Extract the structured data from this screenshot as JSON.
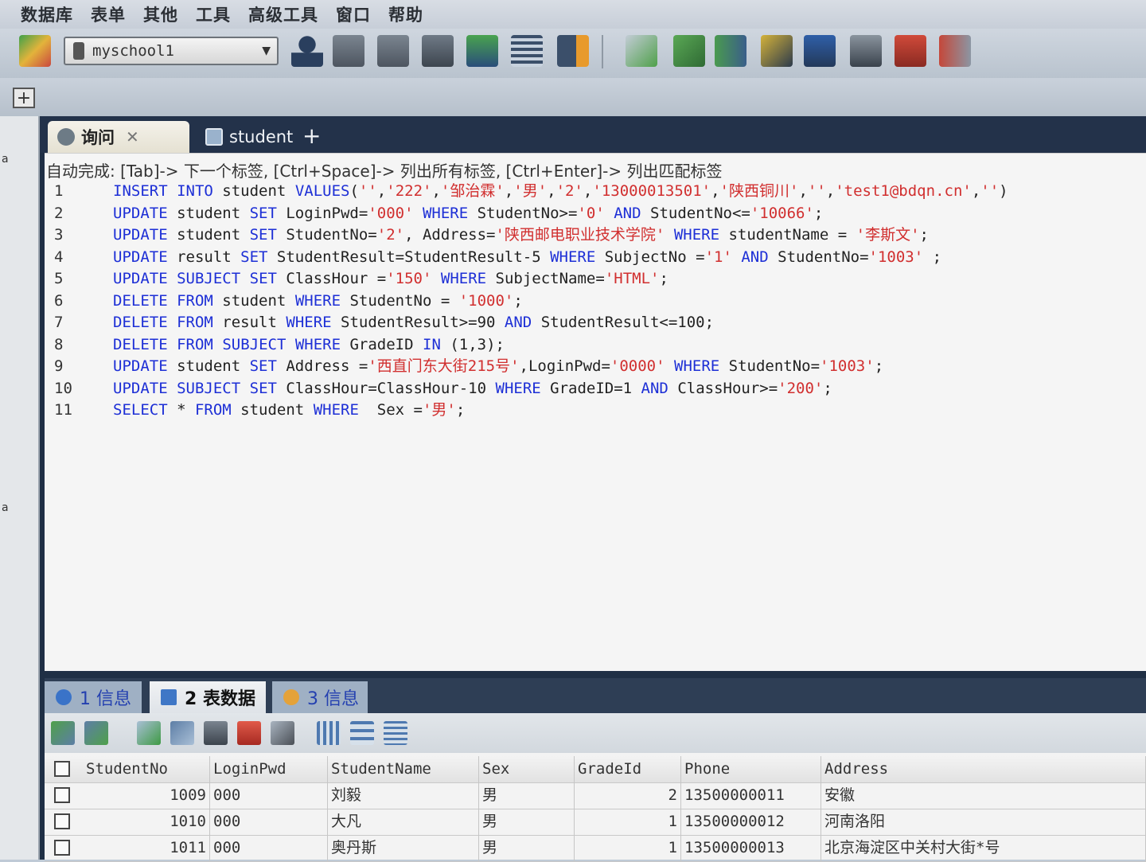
{
  "menu": [
    "数据库",
    "表单",
    "其他",
    "工具",
    "高级工具",
    "窗口",
    "帮助"
  ],
  "toolbar": {
    "database": "myschool1"
  },
  "side_labels": [
    "a",
    "a"
  ],
  "editor_tabs": [
    {
      "label": "询问",
      "active": true
    },
    {
      "label": "student",
      "active": false
    }
  ],
  "editor_hint": "自动完成: [Tab]-> 下一个标签, [Ctrl+Space]-> 列出所有标签, [Ctrl+Enter]-> 列出匹配标签",
  "code_lines": [
    {
      "n": "1",
      "tokens": [
        [
          "k",
          "INSERT"
        ],
        [
          "p",
          " "
        ],
        [
          "k",
          "INTO"
        ],
        [
          "p",
          " student "
        ],
        [
          "k",
          "VALUES"
        ],
        [
          "p",
          "("
        ],
        [
          "s",
          "''"
        ],
        [
          "p",
          ","
        ],
        [
          "s",
          "'222'"
        ],
        [
          "p",
          ","
        ],
        [
          "s",
          "'邹治霖'"
        ],
        [
          "p",
          ","
        ],
        [
          "s",
          "'男'"
        ],
        [
          "p",
          ","
        ],
        [
          "s",
          "'2'"
        ],
        [
          "p",
          ","
        ],
        [
          "s",
          "'13000013501'"
        ],
        [
          "p",
          ","
        ],
        [
          "s",
          "'陕西铜川'"
        ],
        [
          "p",
          ","
        ],
        [
          "s",
          "''"
        ],
        [
          "p",
          ","
        ],
        [
          "s",
          "'test1@bdqn.cn'"
        ],
        [
          "p",
          ","
        ],
        [
          "s",
          "''"
        ],
        [
          "p",
          ")"
        ]
      ]
    },
    {
      "n": "2",
      "tokens": [
        [
          "k",
          "UPDATE"
        ],
        [
          "p",
          " student "
        ],
        [
          "k",
          "SET"
        ],
        [
          "p",
          " LoginPwd="
        ],
        [
          "s",
          "'000'"
        ],
        [
          "p",
          " "
        ],
        [
          "k",
          "WHERE"
        ],
        [
          "p",
          " StudentNo>="
        ],
        [
          "s",
          "'0'"
        ],
        [
          "p",
          " "
        ],
        [
          "k",
          "AND"
        ],
        [
          "p",
          " StudentNo<="
        ],
        [
          "s",
          "'10066'"
        ],
        [
          "p",
          ";"
        ]
      ]
    },
    {
      "n": "3",
      "tokens": [
        [
          "k",
          "UPDATE"
        ],
        [
          "p",
          " student "
        ],
        [
          "k",
          "SET"
        ],
        [
          "p",
          " StudentNo="
        ],
        [
          "s",
          "'2'"
        ],
        [
          "p",
          ", Address="
        ],
        [
          "s",
          "'陕西邮电职业技术学院'"
        ],
        [
          "p",
          " "
        ],
        [
          "k",
          "WHERE"
        ],
        [
          "p",
          " studentName = "
        ],
        [
          "s",
          "'李斯文'"
        ],
        [
          "p",
          ";"
        ]
      ]
    },
    {
      "n": "4",
      "tokens": [
        [
          "k",
          "UPDATE"
        ],
        [
          "p",
          " result "
        ],
        [
          "k",
          "SET"
        ],
        [
          "p",
          " StudentResult=StudentResult-5 "
        ],
        [
          "k",
          "WHERE"
        ],
        [
          "p",
          " SubjectNo ="
        ],
        [
          "s",
          "'1'"
        ],
        [
          "p",
          " "
        ],
        [
          "k",
          "AND"
        ],
        [
          "p",
          " StudentNo="
        ],
        [
          "s",
          "'1003'"
        ],
        [
          "p",
          " ;"
        ]
      ]
    },
    {
      "n": "5",
      "tokens": [
        [
          "k",
          "UPDATE"
        ],
        [
          "p",
          " "
        ],
        [
          "k",
          "SUBJECT"
        ],
        [
          "p",
          " "
        ],
        [
          "k",
          "SET"
        ],
        [
          "p",
          " ClassHour ="
        ],
        [
          "s",
          "'150'"
        ],
        [
          "p",
          " "
        ],
        [
          "k",
          "WHERE"
        ],
        [
          "p",
          " SubjectName="
        ],
        [
          "s",
          "'HTML'"
        ],
        [
          "p",
          ";"
        ]
      ]
    },
    {
      "n": "6",
      "tokens": [
        [
          "k",
          "DELETE"
        ],
        [
          "p",
          " "
        ],
        [
          "k",
          "FROM"
        ],
        [
          "p",
          " student "
        ],
        [
          "k",
          "WHERE"
        ],
        [
          "p",
          " StudentNo = "
        ],
        [
          "s",
          "'1000'"
        ],
        [
          "p",
          ";"
        ]
      ]
    },
    {
      "n": "7",
      "tokens": [
        [
          "k",
          "DELETE"
        ],
        [
          "p",
          " "
        ],
        [
          "k",
          "FROM"
        ],
        [
          "p",
          " result "
        ],
        [
          "k",
          "WHERE"
        ],
        [
          "p",
          " StudentResult>=90 "
        ],
        [
          "k",
          "AND"
        ],
        [
          "p",
          " StudentResult<=100;"
        ]
      ]
    },
    {
      "n": "8",
      "tokens": [
        [
          "k",
          "DELETE"
        ],
        [
          "p",
          " "
        ],
        [
          "k",
          "FROM"
        ],
        [
          "p",
          " "
        ],
        [
          "k",
          "SUBJECT"
        ],
        [
          "p",
          " "
        ],
        [
          "k",
          "WHERE"
        ],
        [
          "p",
          " GradeID "
        ],
        [
          "k",
          "IN"
        ],
        [
          "p",
          " (1,3);"
        ]
      ]
    },
    {
      "n": "9",
      "tokens": [
        [
          "k",
          "UPDATE"
        ],
        [
          "p",
          " student "
        ],
        [
          "k",
          "SET"
        ],
        [
          "p",
          " Address ="
        ],
        [
          "s",
          "'西直门东大街215号'"
        ],
        [
          "p",
          ",LoginPwd="
        ],
        [
          "s",
          "'0000'"
        ],
        [
          "p",
          " "
        ],
        [
          "k",
          "WHERE"
        ],
        [
          "p",
          " StudentNo="
        ],
        [
          "s",
          "'1003'"
        ],
        [
          "p",
          ";"
        ]
      ]
    },
    {
      "n": "10",
      "tokens": [
        [
          "k",
          "UPDATE"
        ],
        [
          "p",
          " "
        ],
        [
          "k",
          "SUBJECT"
        ],
        [
          "p",
          " "
        ],
        [
          "k",
          "SET"
        ],
        [
          "p",
          " ClassHour=ClassHour-10 "
        ],
        [
          "k",
          "WHERE"
        ],
        [
          "p",
          " GradeID=1 "
        ],
        [
          "k",
          "AND"
        ],
        [
          "p",
          " ClassHour>="
        ],
        [
          "s",
          "'200'"
        ],
        [
          "p",
          ";"
        ]
      ]
    },
    {
      "n": "11",
      "tokens": [
        [
          "k",
          "SELECT"
        ],
        [
          "p",
          " * "
        ],
        [
          "k",
          "FROM"
        ],
        [
          "p",
          " student "
        ],
        [
          "k",
          "WHERE"
        ],
        [
          "p",
          "  Sex ="
        ],
        [
          "s",
          "'男'"
        ],
        [
          "p",
          ";"
        ]
      ]
    }
  ],
  "result_tabs": [
    "1 信息",
    "2 表数据",
    "3 信息"
  ],
  "table": {
    "columns": [
      "StudentNo",
      "LoginPwd",
      "StudentName",
      "Sex",
      "GradeId",
      "Phone",
      "Address"
    ],
    "rows": [
      [
        "1009",
        "000",
        "刘毅",
        "男",
        "2",
        "13500000011",
        "安徽"
      ],
      [
        "1010",
        "000",
        "大凡",
        "男",
        "1",
        "13500000012",
        "河南洛阳"
      ],
      [
        "1011",
        "000",
        "奥丹斯",
        "男",
        "1",
        "13500000013",
        "北京海淀区中关村大街*号"
      ]
    ]
  }
}
